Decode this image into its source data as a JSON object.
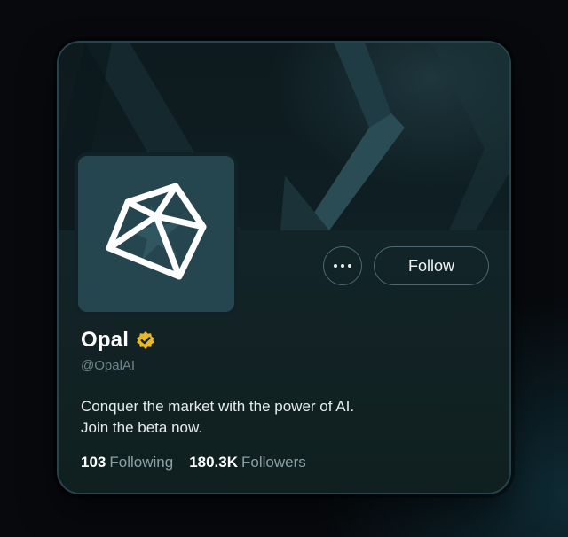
{
  "profile": {
    "name": "Opal",
    "handle": "@OpalAI",
    "verified": true,
    "bio_line1": "Conquer the market with the power of AI.",
    "bio_line2": "Join the beta now.",
    "following_count": "103",
    "following_label": "Following",
    "followers_count": "180.3K",
    "followers_label": "Followers"
  },
  "actions": {
    "follow_label": "Follow",
    "more_icon": "more-horizontal-icon"
  },
  "icons": {
    "avatar_logo": "opal-gem-logo",
    "verified_badge": "verified-badge-icon"
  },
  "colors": {
    "page_background": "#07090c",
    "card_background": "#102127",
    "avatar_background": "#25464e",
    "verified_badge": "#e9b824",
    "accent_border": "#4c6a72"
  }
}
